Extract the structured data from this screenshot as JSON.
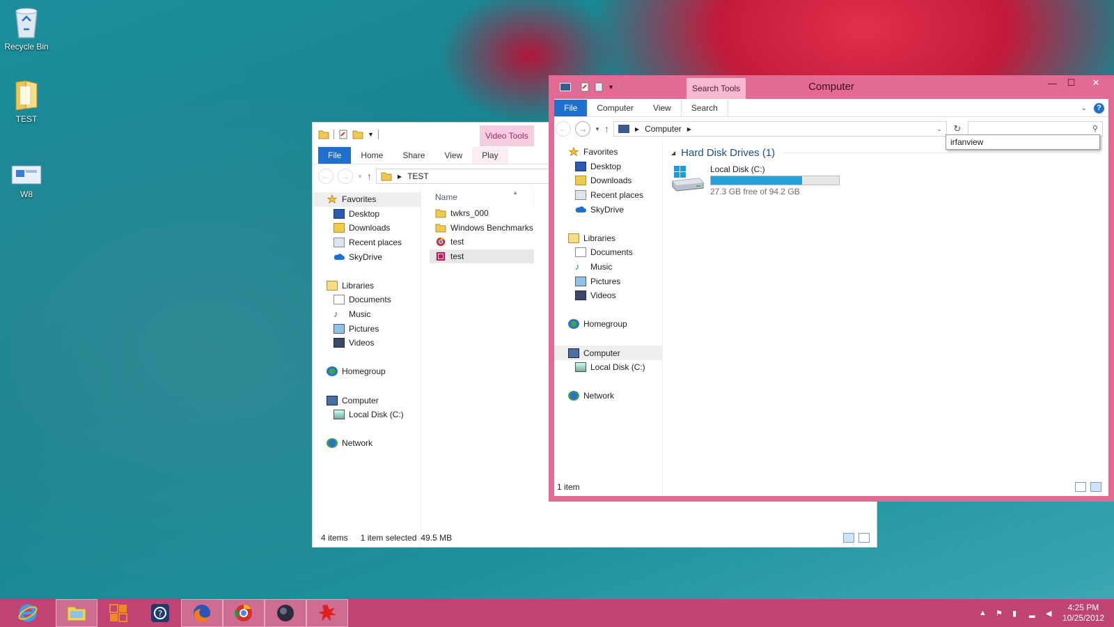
{
  "desktop": {
    "icons": [
      {
        "label": "Recycle Bin",
        "icon": "recycle-bin-icon"
      },
      {
        "label": "TEST",
        "icon": "folder-icon"
      },
      {
        "label": "W8",
        "icon": "shortcut-icon"
      }
    ]
  },
  "back_window": {
    "context_tab": "Video Tools",
    "tabs": [
      "File",
      "Home",
      "Share",
      "View",
      "Play"
    ],
    "address": [
      "TEST"
    ],
    "nav": {
      "favorites": "Favorites",
      "favorites_items": [
        "Desktop",
        "Downloads",
        "Recent places",
        "SkyDrive"
      ],
      "libraries": "Libraries",
      "libraries_items": [
        "Documents",
        "Music",
        "Pictures",
        "Videos"
      ],
      "homegroup": "Homegroup",
      "computer": "Computer",
      "computer_items": [
        "Local Disk (C:)"
      ],
      "network": "Network"
    },
    "column_name": "Name",
    "files": [
      {
        "name": "twkrs_000",
        "icon": "folder-icon"
      },
      {
        "name": "Windows Benchmarks",
        "icon": "folder-icon"
      },
      {
        "name": "test",
        "icon": "chrome-file-icon"
      },
      {
        "name": "test",
        "icon": "video-file-icon"
      }
    ],
    "status": {
      "count": "4 items",
      "selected": "1 item selected",
      "size": "49.5 MB"
    }
  },
  "front_window": {
    "title": "Computer",
    "context_tab": "Search Tools",
    "tabs": [
      "File",
      "Computer",
      "View",
      "Search"
    ],
    "address": [
      "Computer"
    ],
    "search_value": "",
    "autocomplete": "irfanview",
    "nav": {
      "favorites": "Favorites",
      "favorites_items": [
        "Desktop",
        "Downloads",
        "Recent places",
        "SkyDrive"
      ],
      "libraries": "Libraries",
      "libraries_items": [
        "Documents",
        "Music",
        "Pictures",
        "Videos"
      ],
      "homegroup": "Homegroup",
      "computer": "Computer",
      "computer_items": [
        "Local Disk (C:)"
      ],
      "network": "Network"
    },
    "group_title": "Hard Disk Drives (1)",
    "drive": {
      "name": "Local Disk (C:)",
      "free": "27.3 GB free of 94.2 GB",
      "used_fraction": 0.71
    },
    "status": "1 item"
  },
  "taskbar": {
    "apps": [
      "internet-explorer-icon",
      "file-explorer-icon",
      "metro-app-icon",
      "help-app-icon",
      "firefox-icon",
      "chrome-icon",
      "media-app-icon",
      "paint-splash-icon"
    ],
    "time": "4:25 PM",
    "date": "10/25/2012"
  },
  "colors": {
    "accent": "#e26a95",
    "taskbar": "#c04473",
    "file_tab": "#1e6fcf",
    "drive_bar": "#26a0da"
  }
}
